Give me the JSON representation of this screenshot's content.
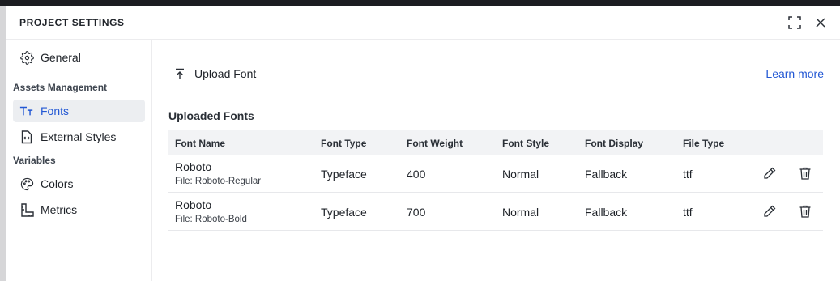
{
  "header": {
    "title": "PROJECT SETTINGS",
    "expand_icon": "expand-icon",
    "close_icon": "close-icon"
  },
  "sidebar": {
    "general": {
      "label": "General",
      "icon": "gear-icon"
    },
    "assets_group": "Assets Management",
    "fonts": {
      "label": "Fonts",
      "icon": "font-icon",
      "active": true
    },
    "external_styles": {
      "label": "External Styles",
      "icon": "file-code-icon"
    },
    "variables_group": "Variables",
    "colors": {
      "label": "Colors",
      "icon": "palette-icon"
    },
    "metrics": {
      "label": "Metrics",
      "icon": "ruler-icon"
    }
  },
  "main": {
    "upload_label": "Upload Font",
    "learn_more": "Learn more",
    "section_title": "Uploaded Fonts",
    "columns": [
      "Font Name",
      "Font Type",
      "Font Weight",
      "Font Style",
      "Font Display",
      "File Type"
    ],
    "rows": [
      {
        "name": "Roboto",
        "file": "File: Roboto-Regular",
        "type": "Typeface",
        "weight": "400",
        "style": "Normal",
        "display": "Fallback",
        "file_type": "ttf"
      },
      {
        "name": "Roboto",
        "file": "File: Roboto-Bold",
        "type": "Typeface",
        "weight": "700",
        "style": "Normal",
        "display": "Fallback",
        "file_type": "ttf"
      }
    ]
  },
  "colors": {
    "accent": "#2358d4",
    "active_bg": "#eceef1",
    "table_header_bg": "#f2f3f5",
    "top_bar": "#1c1d21"
  }
}
